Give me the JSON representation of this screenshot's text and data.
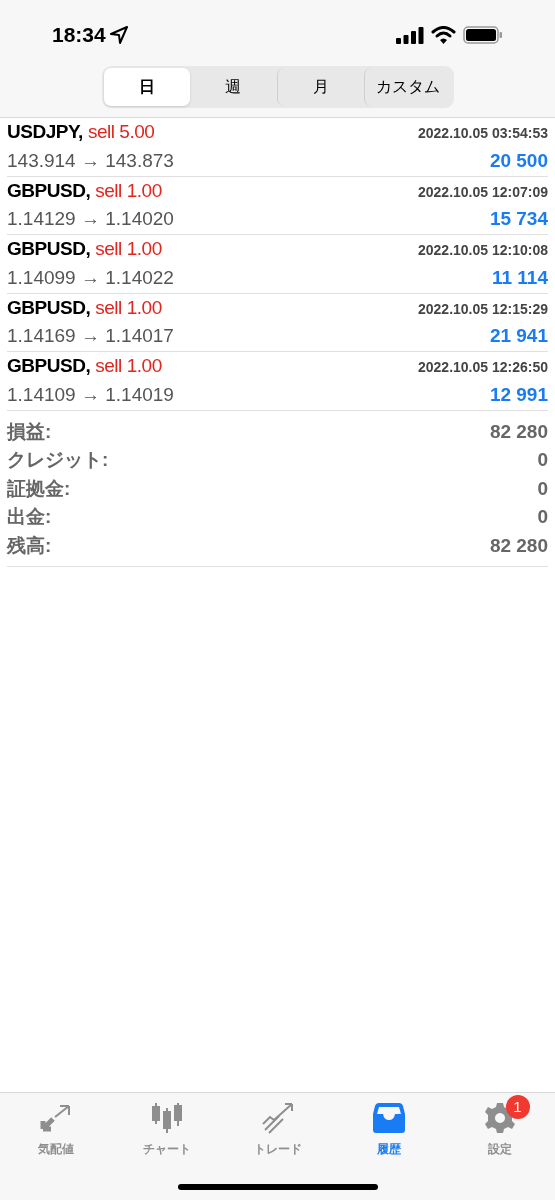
{
  "status_bar": {
    "time": "18:34"
  },
  "periods": [
    {
      "label": "日",
      "selected": true
    },
    {
      "label": "週",
      "selected": false
    },
    {
      "label": "月",
      "selected": false
    },
    {
      "label": "カスタム",
      "selected": false
    }
  ],
  "trades": [
    {
      "symbol": "USDJPY,",
      "action": "sell 5.00",
      "time": "2022.10.05 03:54:53",
      "prices": "143.914 → 143.873",
      "profit": "20 500"
    },
    {
      "symbol": "GBPUSD,",
      "action": "sell 1.00",
      "time": "2022.10.05 12:07:09",
      "prices": "1.14129 → 1.14020",
      "profit": "15 734"
    },
    {
      "symbol": "GBPUSD,",
      "action": "sell 1.00",
      "time": "2022.10.05 12:10:08",
      "prices": "1.14099 → 1.14022",
      "profit": "11 114"
    },
    {
      "symbol": "GBPUSD,",
      "action": "sell 1.00",
      "time": "2022.10.05 12:15:29",
      "prices": "1.14169 → 1.14017",
      "profit": "21 941"
    },
    {
      "symbol": "GBPUSD,",
      "action": "sell 1.00",
      "time": "2022.10.05 12:26:50",
      "prices": "1.14109 → 1.14019",
      "profit": "12 991"
    }
  ],
  "summary": [
    {
      "label": "損益:",
      "value": "82 280"
    },
    {
      "label": "クレジット:",
      "value": "0"
    },
    {
      "label": "証拠金:",
      "value": "0"
    },
    {
      "label": "出金:",
      "value": "0"
    },
    {
      "label": "残高:",
      "value": "82 280"
    }
  ],
  "tab_bar": [
    {
      "kind": "quotes",
      "label": "気配値",
      "selected": false
    },
    {
      "kind": "chart",
      "label": "チャート",
      "selected": false
    },
    {
      "kind": "trade",
      "label": "トレード",
      "selected": false
    },
    {
      "kind": "history",
      "label": "履歴",
      "selected": true
    },
    {
      "kind": "settings",
      "label": "設定",
      "selected": false,
      "badge": "1"
    }
  ]
}
